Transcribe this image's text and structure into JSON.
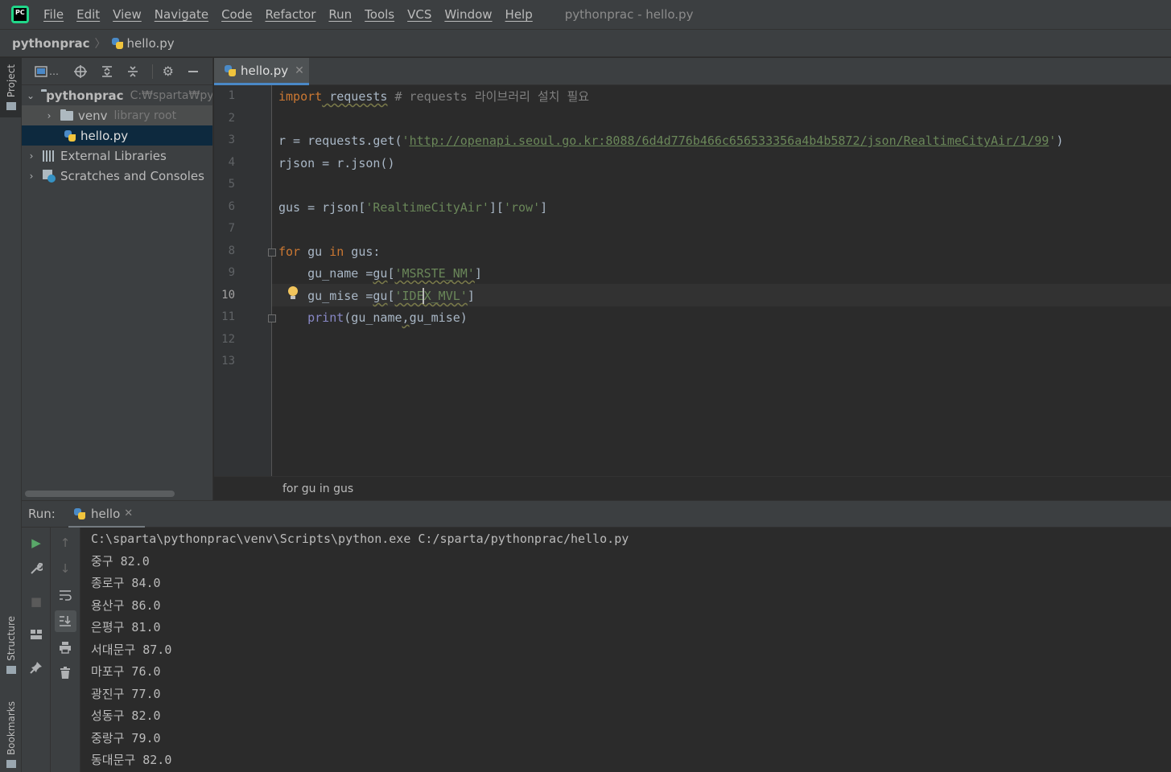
{
  "app": {
    "logo_text": "PC",
    "menu": [
      "File",
      "Edit",
      "View",
      "Navigate",
      "Code",
      "Refactor",
      "Run",
      "Tools",
      "VCS",
      "Window",
      "Help"
    ],
    "window_title": "pythonprac - hello.py"
  },
  "breadcrumb": {
    "project": "pythonprac",
    "file": "hello.py"
  },
  "left_strip": {
    "project": "Project",
    "structure": "Structure",
    "bookmarks": "Bookmarks"
  },
  "project_panel": {
    "toolbar": {
      "view_mode": "…"
    },
    "tree": [
      {
        "label": "pythonprac",
        "hint": "C:₩sparta₩pyt"
      },
      {
        "label": "venv",
        "hint": "library root"
      },
      {
        "label": "hello.py",
        "hint": ""
      },
      {
        "label": "External Libraries",
        "hint": ""
      },
      {
        "label": "Scratches and Consoles",
        "hint": ""
      }
    ]
  },
  "editor": {
    "tab_label": "hello.py",
    "line_numbers": [
      "1",
      "2",
      "3",
      "4",
      "5",
      "6",
      "7",
      "8",
      "9",
      "10",
      "11",
      "12",
      "13"
    ],
    "current_line": "10",
    "code": {
      "l1_kw": "import",
      "l1_mod": " requests",
      "l1_cmt": " # requests 라이브러리 설치 필요",
      "l3_a": "r = requests.get(",
      "l3_q1": "'",
      "l3_url": "http://openapi.seoul.go.kr:8088/6d4d776b466c656533356a4b4b5872/json/RealtimeCityAir/1/99",
      "l3_q2": "'",
      "l3_b": ")",
      "l4": "rjson = r.json()",
      "l6_a": "gus = rjson[",
      "l6_s1": "'RealtimeCityAir'",
      "l6_b": "][",
      "l6_s2": "'row'",
      "l6_c": "]",
      "l8_kw1": "for",
      "l8_a": " gu ",
      "l8_kw2": "in",
      "l8_b": " gus:",
      "l9_a": "    gu_name =",
      "l9_gu": "gu",
      "l9_b": "[",
      "l9_s": "'MSRSTE_NM'",
      "l9_c": "]",
      "l10_a": "    gu_mise =",
      "l10_gu": "gu",
      "l10_b": "[",
      "l10_s": "'IDEX_MVL'",
      "l10_c": "]",
      "l11_ind": "    ",
      "l11_fn": "print",
      "l11_a": "(gu_name",
      "l11_comma": ",",
      "l11_b": "gu_mise)"
    },
    "crumb": "for gu in gus"
  },
  "run": {
    "label": "Run:",
    "tab_label": "hello",
    "output": [
      "C:\\sparta\\pythonprac\\venv\\Scripts\\python.exe C:/sparta/pythonprac/hello.py",
      "중구 82.0",
      "종로구 84.0",
      "용산구 86.0",
      "은평구 81.0",
      "서대문구 87.0",
      "마포구 76.0",
      "광진구 77.0",
      "성동구 82.0",
      "중랑구 79.0",
      "동대문구 82.0"
    ]
  },
  "colors": {
    "keyword": "#cc7832",
    "string": "#6a8759",
    "comment": "#808080",
    "builtin": "#8888c6",
    "text": "#a9b7c6",
    "accent": "#4a88c7"
  },
  "icons": [
    "run-icon",
    "wrench-icon",
    "stop-icon",
    "layout-icon",
    "pin-icon",
    "up-arrow-icon",
    "down-arrow-icon",
    "soft-wrap-icon",
    "scroll-to-end-icon",
    "print-icon",
    "trash-icon",
    "locate-icon",
    "expand-all-icon",
    "collapse-all-icon",
    "gear-icon",
    "minimize-icon",
    "lightbulb-icon",
    "python-file-icon",
    "folder-icon"
  ]
}
